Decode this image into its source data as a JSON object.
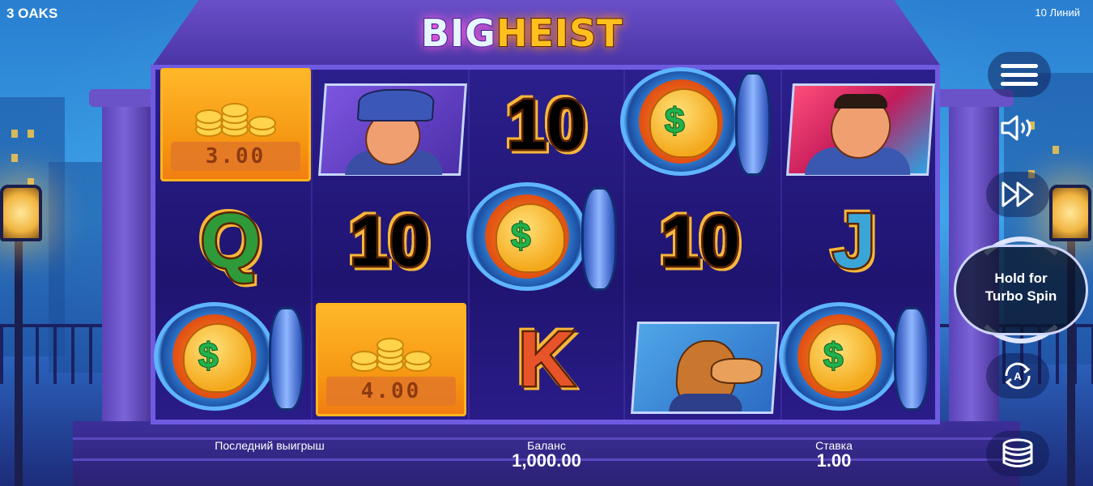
{
  "brand": "3 OAKS",
  "lines_label": "10 Линий",
  "logo": {
    "part1": "BIG",
    "part2": "HEIST"
  },
  "reels": [
    {
      "col": 1,
      "symbols": [
        "coin-card",
        "Q",
        "vault-bag"
      ]
    },
    {
      "col": 2,
      "symbols": [
        "policeman",
        "10",
        "coin-card"
      ]
    },
    {
      "col": 3,
      "symbols": [
        "10",
        "vault-bag",
        "K"
      ]
    },
    {
      "col": 4,
      "symbols": [
        "vault-bag",
        "10",
        "dog"
      ]
    },
    {
      "col": 5,
      "symbols": [
        "boss",
        "J",
        "vault-bag"
      ]
    }
  ],
  "symbols": {
    "ten": "10",
    "q": "Q",
    "j": "J",
    "k": "K",
    "dollar": "$"
  },
  "coin_values": {
    "top_left": "3.00",
    "bottom_mid": "4.00"
  },
  "controls": {
    "menu": "menu-icon",
    "sound": "speaker-icon",
    "fast": "fast-forward-icon",
    "turbo_text_line1": "Hold for",
    "turbo_text_line2": "Turbo Spin",
    "autoplay": "autoplay-icon",
    "bet": "coin-stack-icon"
  },
  "bottom": {
    "last_win_label": "Последний выигрыш",
    "balance_label": "Баланс",
    "balance_value": "1,000.00",
    "bet_label": "Ставка",
    "bet_value": "1.00"
  },
  "colors": {
    "reel_bg": "#1f1470",
    "frame": "#6f5be0",
    "coin_card": "#f59410",
    "accent_gold": "#ffc01e"
  }
}
